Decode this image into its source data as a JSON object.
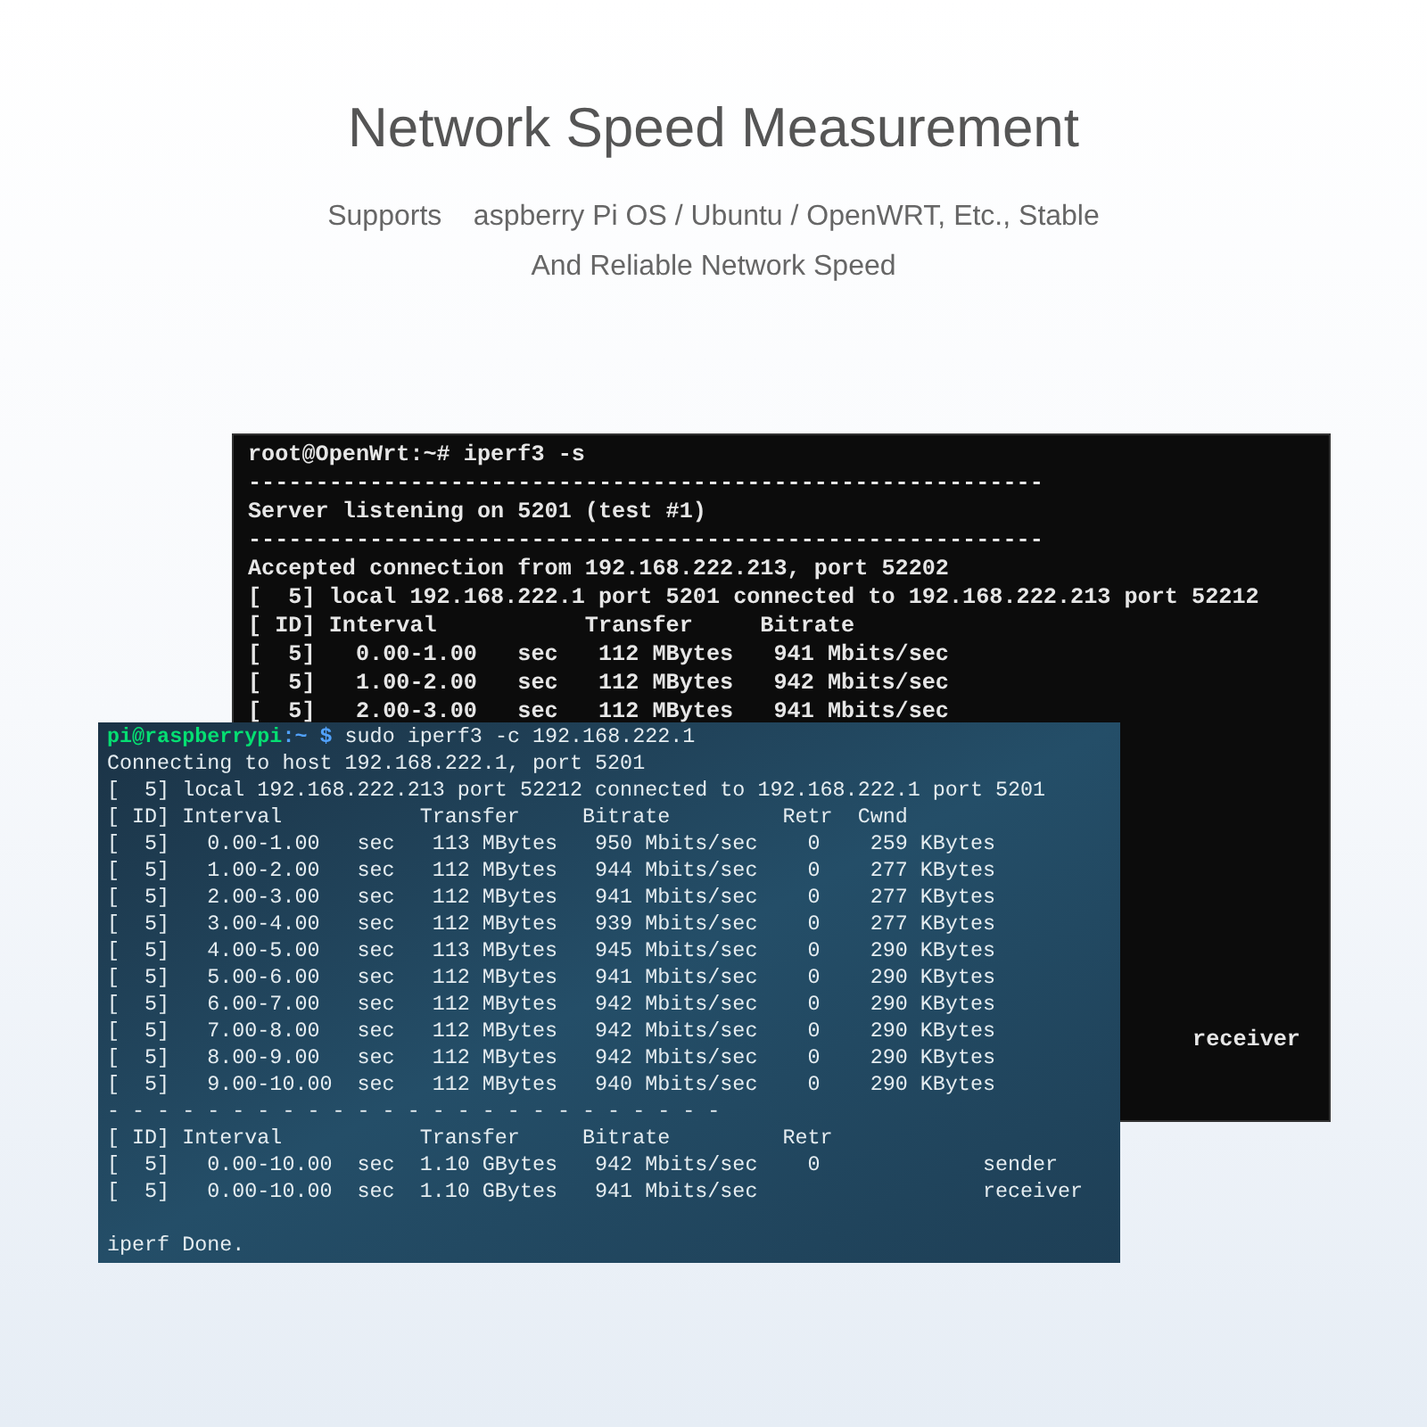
{
  "title": "Network Speed Measurement",
  "subtitle_lines": [
    "Supports    aspberry Pi OS / Ubuntu / OpenWRT, Etc., Stable",
    "And Reliable Network Speed"
  ],
  "server_terminal": {
    "lines": [
      "root@OpenWrt:~# iperf3 -s",
      "-----------------------------------------------------------",
      "Server listening on 5201 (test #1)",
      "-----------------------------------------------------------",
      "Accepted connection from 192.168.222.213, port 52202",
      "[  5] local 192.168.222.1 port 5201 connected to 192.168.222.213 port 52212",
      "[ ID] Interval           Transfer     Bitrate",
      "[  5]   0.00-1.00   sec   112 MBytes   941 Mbits/sec",
      "[  5]   1.00-2.00   sec   112 MBytes   942 Mbits/sec",
      "[  5]   2.00-3.00   sec   112 MBytes   941 Mbits/sec"
    ],
    "trailing_text": "receiver"
  },
  "client_terminal": {
    "prompt": {
      "user": "pi@raspberrypi",
      "path": ":~ $",
      "command": " sudo iperf3 -c 192.168.222.1"
    },
    "lines": [
      "Connecting to host 192.168.222.1, port 5201",
      "[  5] local 192.168.222.213 port 52212 connected to 192.168.222.1 port 5201",
      "[ ID] Interval           Transfer     Bitrate         Retr  Cwnd",
      "[  5]   0.00-1.00   sec   113 MBytes   950 Mbits/sec    0    259 KBytes",
      "[  5]   1.00-2.00   sec   112 MBytes   944 Mbits/sec    0    277 KBytes",
      "[  5]   2.00-3.00   sec   112 MBytes   941 Mbits/sec    0    277 KBytes",
      "[  5]   3.00-4.00   sec   112 MBytes   939 Mbits/sec    0    277 KBytes",
      "[  5]   4.00-5.00   sec   113 MBytes   945 Mbits/sec    0    290 KBytes",
      "[  5]   5.00-6.00   sec   112 MBytes   941 Mbits/sec    0    290 KBytes",
      "[  5]   6.00-7.00   sec   112 MBytes   942 Mbits/sec    0    290 KBytes",
      "[  5]   7.00-8.00   sec   112 MBytes   942 Mbits/sec    0    290 KBytes",
      "[  5]   8.00-9.00   sec   112 MBytes   942 Mbits/sec    0    290 KBytes",
      "[  5]   9.00-10.00  sec   112 MBytes   940 Mbits/sec    0    290 KBytes",
      "- - - - - - - - - - - - - - - - - - - - - - - - -",
      "[ ID] Interval           Transfer     Bitrate         Retr",
      "[  5]   0.00-10.00  sec  1.10 GBytes   942 Mbits/sec    0             sender",
      "[  5]   0.00-10.00  sec  1.10 GBytes   941 Mbits/sec                  receiver"
    ],
    "done_line": "iperf Done."
  }
}
